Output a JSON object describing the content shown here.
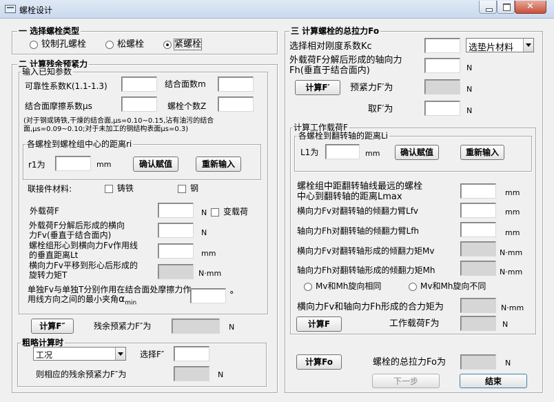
{
  "window": {
    "title": "螺栓设计"
  },
  "s1": {
    "title": "一 选择螺栓类型",
    "radios": [
      {
        "label": "铰制孔螺栓",
        "checked": false
      },
      {
        "label": "松螺栓",
        "checked": false
      },
      {
        "label": "紧螺栓",
        "checked": true
      }
    ]
  },
  "s2": {
    "title": "二 计算残余预紧力",
    "input_known": {
      "title": "输入已知参数",
      "k_label": "可靠性系数K(1.1-1.3)",
      "m_label": "结合面数m",
      "mu_label": "结合面摩擦系数μs",
      "z_label": "螺栓个数Z",
      "note": "(对于钢或铸铁,干燥的结合面,μs=0.10~0.15,沾有油污的结合面,μs=0.09~0.10;对于未加工的钢结构表面μs=0.3)"
    },
    "ri": {
      "title": "各螺栓到螺栓组中心的距离ri",
      "r1_label": "r1为",
      "r1_unit": "mm",
      "confirm": "确认赋值",
      "reinput": "重新输入"
    },
    "material": {
      "label": "联接件材料:",
      "opt1": "铸铁",
      "opt2": "钢"
    },
    "f": {
      "label": "外载荷F",
      "unit": "N",
      "variable": "变载荷"
    },
    "fv": {
      "label": "外载荷F分解后形成的横向力Fv(垂直于结合面内)",
      "unit": "N"
    },
    "lt": {
      "label": "螺栓组形心到横向力Fv作用线的垂直距离Lt",
      "unit": "mm"
    },
    "t": {
      "label": "横向力Fv平移到形心后形成的旋转力矩T",
      "unit": "N·mm"
    },
    "amin": {
      "label": "单独Fv与单独T分别作用在结合面处摩擦力作用线方向之间的最小夹角",
      "alpha": "α",
      "sub": "min",
      "unit": "°"
    },
    "calc": {
      "button": "计算F″",
      "result_label": "残余预紧力F″为",
      "unit": "N"
    },
    "rough": {
      "title": "粗略计算时",
      "select_value": "工况",
      "choose_label": "选择F″",
      "result_label": "则相应的残余预紧力F″为",
      "unit": "N"
    }
  },
  "s3": {
    "title": "三 计算螺栓的总拉力Fo",
    "kc_label": "选择相对刚度系数Kc",
    "gasket_select": "选垫片材料",
    "fh_label": "外载荷F分解后形成的轴向力Fh(垂直于结合面内)",
    "fh_unit": "N",
    "calc_fp": "计算F′",
    "preload_label": "预紧力F′为",
    "preload_unit": "N",
    "take_label": "取F′为",
    "take_unit": "N",
    "work": {
      "title": "计算工作载荷F",
      "li": {
        "title": "各螺栓到翻转轴的距离Li",
        "l1_label": "L1为",
        "l1_unit": "mm",
        "confirm": "确认赋值",
        "reinput": "重新输入"
      },
      "lmax_label": "螺栓组中距翻转轴线最远的螺栓中心到翻转轴的距离Lmax",
      "lmax_unit": "mm",
      "lfv_label": "横向力Fv对翻转轴的倾翻力臂Lfv",
      "lfv_unit": "mm",
      "lfh_label": "轴向力Fh对翻转轴的倾翻力臂Lfh",
      "lfh_unit": "mm",
      "mv_label": "横向力Fv对翻转轴形成的倾翻力矩Mv",
      "mv_unit": "N·mm",
      "mh_label": "轴向力Fh对翻转轴形成的倾翻力矩Mh",
      "mh_unit": "N·mm",
      "same": "Mv和Mh旋向相同",
      "diff": "Mv和Mh旋向不同",
      "resultant_label": "横向力Fv和轴向力Fh形成的合力矩为",
      "resultant_unit": "N·mm",
      "calc_f": "计算F",
      "work_label": "工作载荷F为",
      "work_unit": "N"
    },
    "calc_fo": "计算Fo",
    "total_label": "螺栓的总拉力Fo为",
    "total_unit": "N",
    "next": "下一步",
    "finish": "结束"
  }
}
